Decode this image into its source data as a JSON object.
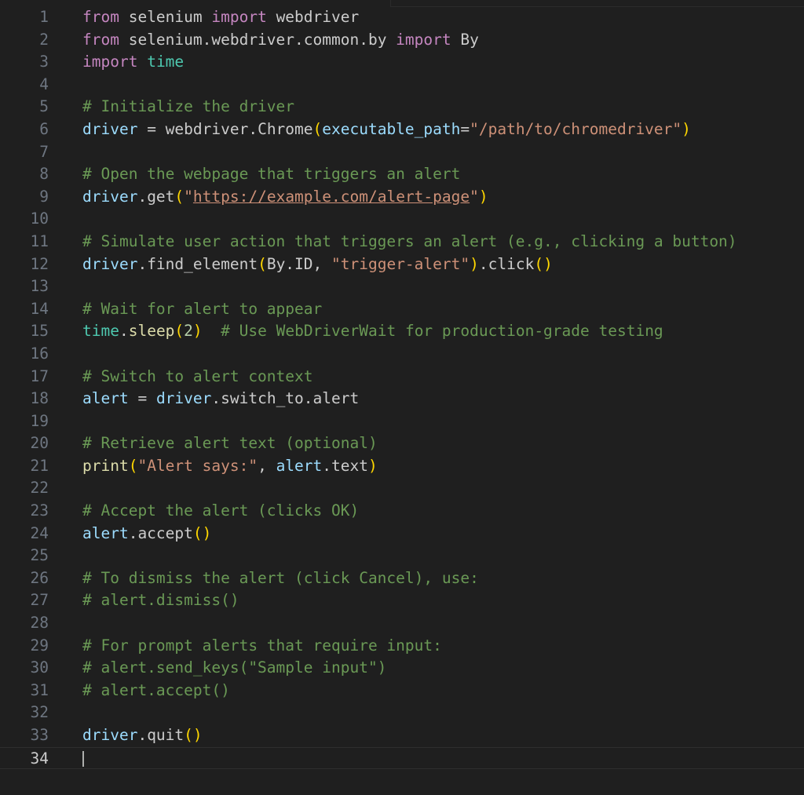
{
  "editor": {
    "current_line": 34,
    "lines": [
      {
        "n": "1",
        "tokens": [
          {
            "t": "from",
            "c": "kw"
          },
          {
            "t": " selenium ",
            "c": "txt"
          },
          {
            "t": "import",
            "c": "kw"
          },
          {
            "t": " webdriver",
            "c": "txt"
          }
        ]
      },
      {
        "n": "2",
        "tokens": [
          {
            "t": "from",
            "c": "kw"
          },
          {
            "t": " selenium.webdriver.common.by ",
            "c": "txt"
          },
          {
            "t": "import",
            "c": "kw"
          },
          {
            "t": " By",
            "c": "txt"
          }
        ]
      },
      {
        "n": "3",
        "tokens": [
          {
            "t": "import",
            "c": "kw"
          },
          {
            "t": " ",
            "c": "txt"
          },
          {
            "t": "time",
            "c": "mod"
          }
        ]
      },
      {
        "n": "4",
        "tokens": []
      },
      {
        "n": "5",
        "tokens": [
          {
            "t": "# Initialize the driver",
            "c": "cm"
          }
        ]
      },
      {
        "n": "6",
        "tokens": [
          {
            "t": "driver",
            "c": "var"
          },
          {
            "t": " = webdriver.Chrome",
            "c": "txt"
          },
          {
            "t": "(",
            "c": "p1"
          },
          {
            "t": "executable_path",
            "c": "var"
          },
          {
            "t": "=",
            "c": "txt"
          },
          {
            "t": "\"/path/to/chromedriver\"",
            "c": "str"
          },
          {
            "t": ")",
            "c": "p1"
          }
        ]
      },
      {
        "n": "7",
        "tokens": []
      },
      {
        "n": "8",
        "tokens": [
          {
            "t": "# Open the webpage that triggers an alert",
            "c": "cm"
          }
        ]
      },
      {
        "n": "9",
        "tokens": [
          {
            "t": "driver",
            "c": "var"
          },
          {
            "t": ".get",
            "c": "txt"
          },
          {
            "t": "(",
            "c": "p1"
          },
          {
            "t": "\"",
            "c": "str"
          },
          {
            "t": "https://example.com/alert-page",
            "c": "link"
          },
          {
            "t": "\"",
            "c": "str"
          },
          {
            "t": ")",
            "c": "p1"
          }
        ]
      },
      {
        "n": "10",
        "tokens": []
      },
      {
        "n": "11",
        "tokens": [
          {
            "t": "# Simulate user action that triggers an alert (e.g., clicking a button)",
            "c": "cm"
          }
        ]
      },
      {
        "n": "12",
        "tokens": [
          {
            "t": "driver",
            "c": "var"
          },
          {
            "t": ".find_element",
            "c": "txt"
          },
          {
            "t": "(",
            "c": "p1"
          },
          {
            "t": "By.ID, ",
            "c": "txt"
          },
          {
            "t": "\"trigger-alert\"",
            "c": "str"
          },
          {
            "t": ")",
            "c": "p1"
          },
          {
            "t": ".click",
            "c": "txt"
          },
          {
            "t": "()",
            "c": "p1"
          }
        ]
      },
      {
        "n": "13",
        "tokens": []
      },
      {
        "n": "14",
        "tokens": [
          {
            "t": "# Wait for alert to appear",
            "c": "cm"
          }
        ]
      },
      {
        "n": "15",
        "tokens": [
          {
            "t": "time",
            "c": "mod"
          },
          {
            "t": ".",
            "c": "txt"
          },
          {
            "t": "sleep",
            "c": "fn"
          },
          {
            "t": "(",
            "c": "p1"
          },
          {
            "t": "2",
            "c": "num"
          },
          {
            "t": ")",
            "c": "p1"
          },
          {
            "t": "  ",
            "c": "txt"
          },
          {
            "t": "# Use WebDriverWait for production-grade testing",
            "c": "cm"
          }
        ]
      },
      {
        "n": "16",
        "tokens": []
      },
      {
        "n": "17",
        "tokens": [
          {
            "t": "# Switch to alert context",
            "c": "cm"
          }
        ]
      },
      {
        "n": "18",
        "tokens": [
          {
            "t": "alert",
            "c": "var"
          },
          {
            "t": " = ",
            "c": "txt"
          },
          {
            "t": "driver",
            "c": "var"
          },
          {
            "t": ".switch_to.alert",
            "c": "txt"
          }
        ]
      },
      {
        "n": "19",
        "tokens": []
      },
      {
        "n": "20",
        "tokens": [
          {
            "t": "# Retrieve alert text (optional)",
            "c": "cm"
          }
        ]
      },
      {
        "n": "21",
        "tokens": [
          {
            "t": "print",
            "c": "fn"
          },
          {
            "t": "(",
            "c": "p1"
          },
          {
            "t": "\"Alert says:\"",
            "c": "str"
          },
          {
            "t": ", ",
            "c": "txt"
          },
          {
            "t": "alert",
            "c": "var"
          },
          {
            "t": ".text",
            "c": "txt"
          },
          {
            "t": ")",
            "c": "p1"
          }
        ]
      },
      {
        "n": "22",
        "tokens": []
      },
      {
        "n": "23",
        "tokens": [
          {
            "t": "# Accept the alert (clicks OK)",
            "c": "cm"
          }
        ]
      },
      {
        "n": "24",
        "tokens": [
          {
            "t": "alert",
            "c": "var"
          },
          {
            "t": ".accept",
            "c": "txt"
          },
          {
            "t": "()",
            "c": "p1"
          }
        ]
      },
      {
        "n": "25",
        "tokens": []
      },
      {
        "n": "26",
        "tokens": [
          {
            "t": "# To dismiss the alert (click Cancel), use:",
            "c": "cm"
          }
        ]
      },
      {
        "n": "27",
        "tokens": [
          {
            "t": "# alert.dismiss()",
            "c": "cm"
          }
        ]
      },
      {
        "n": "28",
        "tokens": []
      },
      {
        "n": "29",
        "tokens": [
          {
            "t": "# For prompt alerts that require input:",
            "c": "cm"
          }
        ]
      },
      {
        "n": "30",
        "tokens": [
          {
            "t": "# alert.send_keys(\"Sample input\")",
            "c": "cm"
          }
        ]
      },
      {
        "n": "31",
        "tokens": [
          {
            "t": "# alert.accept()",
            "c": "cm"
          }
        ]
      },
      {
        "n": "32",
        "tokens": []
      },
      {
        "n": "33",
        "tokens": [
          {
            "t": "driver",
            "c": "var"
          },
          {
            "t": ".quit",
            "c": "txt"
          },
          {
            "t": "()",
            "c": "p1"
          }
        ]
      },
      {
        "n": "34",
        "tokens": []
      }
    ]
  }
}
